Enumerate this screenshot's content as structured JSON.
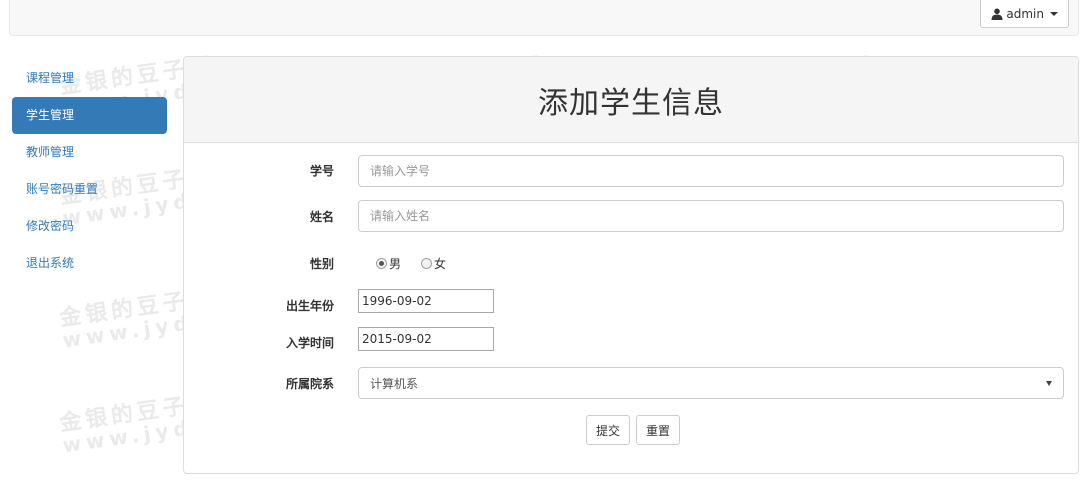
{
  "header": {
    "username": "admin",
    "user_icon": "user-icon"
  },
  "sidebar": {
    "items": [
      {
        "label": "课程管理",
        "active": false
      },
      {
        "label": "学生管理",
        "active": true
      },
      {
        "label": "教师管理",
        "active": false
      },
      {
        "label": "账号密码重置",
        "active": false
      },
      {
        "label": "修改密码",
        "active": false
      },
      {
        "label": "退出系统",
        "active": false
      }
    ]
  },
  "panel": {
    "title": "添加学生信息"
  },
  "form": {
    "student_id": {
      "label": "学号",
      "placeholder": "请输入学号",
      "value": ""
    },
    "name": {
      "label": "姓名",
      "placeholder": "请输入姓名",
      "value": ""
    },
    "gender": {
      "label": "性别",
      "options": [
        "男",
        "女"
      ],
      "selected": "男"
    },
    "birth": {
      "label": "出生年份",
      "value": "1996-09-02"
    },
    "enroll": {
      "label": "入学时间",
      "value": "2015-09-02"
    },
    "department": {
      "label": "所属院系",
      "selected": "计算机系"
    },
    "submit_label": "提交",
    "reset_label": "重置"
  },
  "watermark": {
    "line1": "金银的豆子网",
    "line2": "www.jyddzi.com"
  },
  "colors": {
    "primary": "#337ab7",
    "panel_heading": "#f5f5f5",
    "border": "#dddddd"
  }
}
